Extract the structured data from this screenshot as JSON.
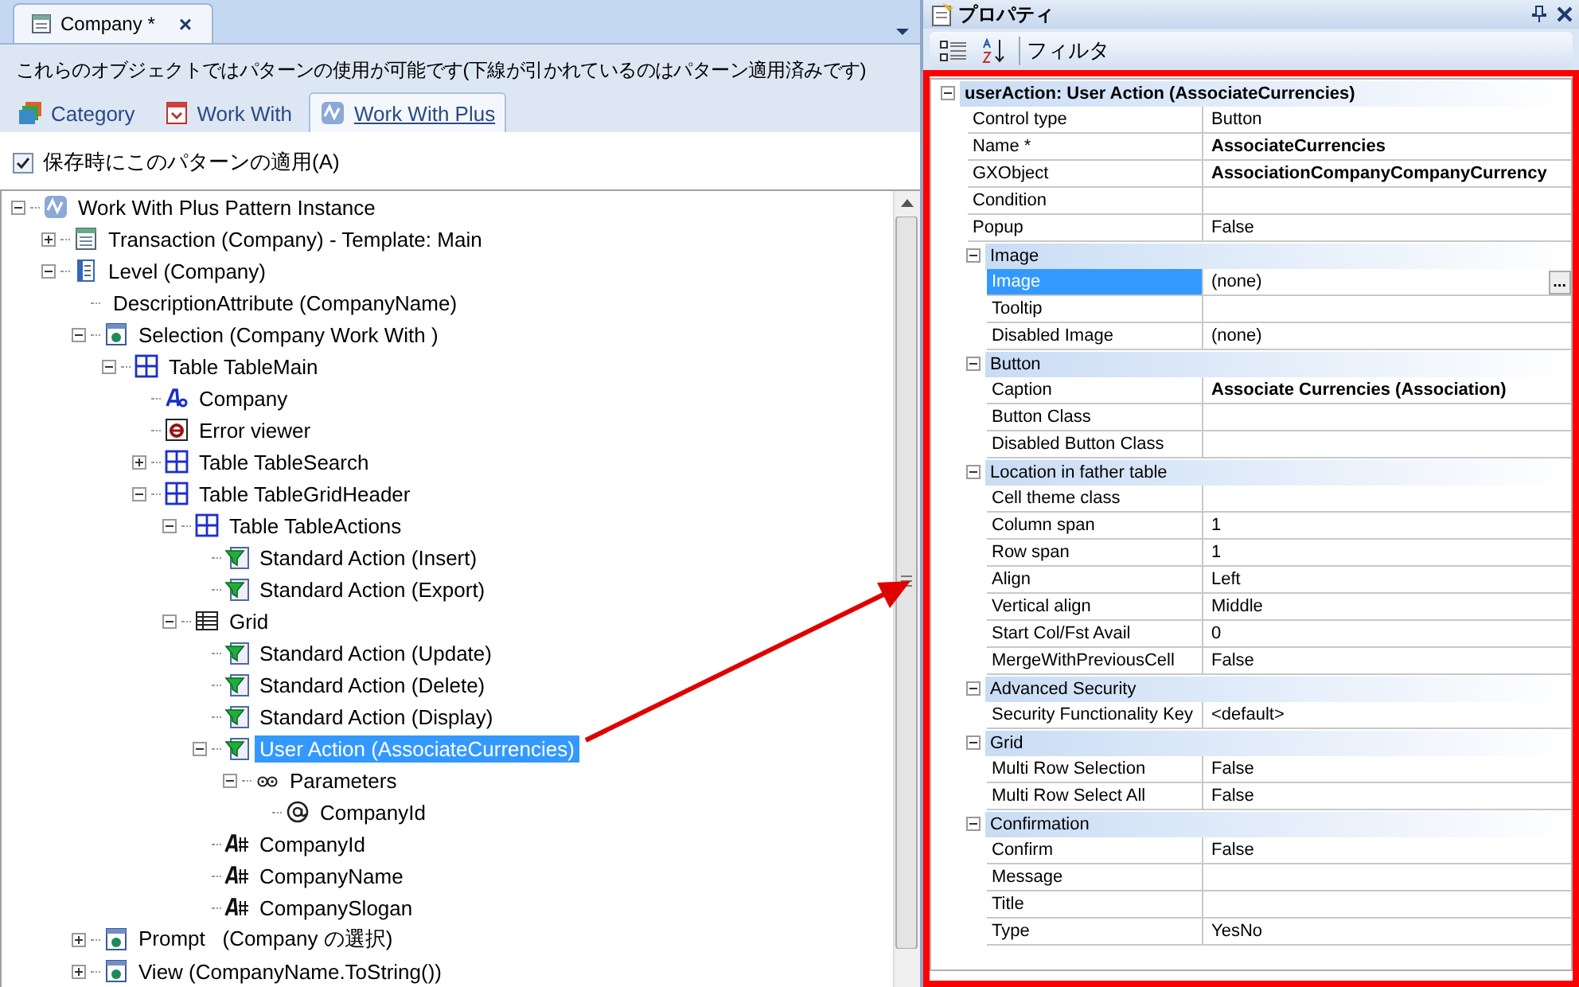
{
  "document_tab": {
    "title": "Company *",
    "close": "×"
  },
  "pattern_hint": "これらのオブジェクトではパターンの使用が可能です(下線が引かれているのはパターン適用済みです)",
  "pattern_tabs": [
    {
      "label": "Category",
      "kind": "category",
      "selected": false
    },
    {
      "label": "Work With",
      "kind": "workwith",
      "selected": false
    },
    {
      "label": "Work With Plus",
      "kind": "workwithplus",
      "selected": true
    }
  ],
  "apply_on_save": {
    "label": "保存時にこのパターンの適用(A)",
    "checked": true
  },
  "tree": [
    {
      "label": "Work With Plus Pattern Instance",
      "kind": "pattern",
      "expanded": true,
      "selected": false,
      "children": [
        {
          "label": "Transaction (Company) - Template: Main",
          "kind": "transaction",
          "expanded": false,
          "selected": false
        },
        {
          "label": "Level (Company)",
          "kind": "level",
          "expanded": true,
          "selected": false,
          "children": [
            {
              "label": "DescriptionAttribute (CompanyName)",
              "kind": "plain",
              "selected": false
            },
            {
              "label": "Selection (Company Work With )",
              "kind": "selection",
              "expanded": true,
              "selected": false,
              "children": [
                {
                  "label": "Table TableMain",
                  "kind": "table",
                  "expanded": true,
                  "selected": false,
                  "children": [
                    {
                      "label": "Company",
                      "kind": "text",
                      "selected": false
                    },
                    {
                      "label": "Error viewer",
                      "kind": "error",
                      "selected": false
                    },
                    {
                      "label": "Table TableSearch",
                      "kind": "table",
                      "expanded": false,
                      "selected": false
                    },
                    {
                      "label": "Table TableGridHeader",
                      "kind": "table",
                      "expanded": true,
                      "selected": false,
                      "children": [
                        {
                          "label": "Table TableActions",
                          "kind": "table",
                          "expanded": true,
                          "selected": false,
                          "children": [
                            {
                              "label": "Standard Action (Insert)",
                              "kind": "action",
                              "selected": false
                            },
                            {
                              "label": "Standard Action (Export)",
                              "kind": "action",
                              "selected": false
                            }
                          ]
                        },
                        {
                          "label": "Grid",
                          "kind": "grid",
                          "expanded": true,
                          "selected": false,
                          "children": [
                            {
                              "label": "Standard Action (Update)",
                              "kind": "action",
                              "selected": false
                            },
                            {
                              "label": "Standard Action (Delete)",
                              "kind": "action",
                              "selected": false
                            },
                            {
                              "label": "Standard Action (Display)",
                              "kind": "action",
                              "selected": false
                            },
                            {
                              "label": "User Action (AssociateCurrencies)",
                              "kind": "action",
                              "expanded": true,
                              "selected": true,
                              "children": [
                                {
                                  "label": "Parameters",
                                  "kind": "parameters",
                                  "expanded": true,
                                  "selected": false,
                                  "children": [
                                    {
                                      "label": "CompanyId",
                                      "kind": "parameter",
                                      "selected": false
                                    }
                                  ]
                                }
                              ]
                            },
                            {
                              "label": "CompanyId",
                              "kind": "attribute",
                              "selected": false
                            },
                            {
                              "label": "CompanyName",
                              "kind": "attribute",
                              "selected": false
                            },
                            {
                              "label": "CompanySlogan",
                              "kind": "attribute",
                              "selected": false
                            }
                          ]
                        }
                      ]
                    }
                  ]
                }
              ]
            },
            {
              "label": "Prompt   (Company の選択)",
              "kind": "selection",
              "expanded": false,
              "selected": false
            },
            {
              "label": "View (CompanyName.ToString())",
              "kind": "selection",
              "expanded": false,
              "selected": false
            }
          ]
        }
      ]
    }
  ],
  "properties_panel": {
    "title": "プロパティ",
    "filter_label": "フィルタ"
  },
  "properties": {
    "title": "userAction: User Action (AssociateCurrencies)",
    "expanded": true,
    "items": [
      {
        "name": "Control type",
        "value": "Button",
        "modified": false,
        "selected": false
      },
      {
        "name": "Name *",
        "value": "AssociateCurrencies",
        "modified": true,
        "selected": false
      },
      {
        "name": "GXObject",
        "value": "AssociationCompanyCompanyCurrency",
        "modified": true,
        "selected": false
      },
      {
        "name": "Condition",
        "modified": false,
        "selected": false
      },
      {
        "name": "Popup",
        "value": "False",
        "modified": false,
        "selected": false
      }
    ],
    "categories": [
      {
        "title": "Image",
        "expanded": true,
        "items": [
          {
            "name": "Image",
            "value": "(none)",
            "ellipsis": "...",
            "modified": false,
            "selected": true
          },
          {
            "name": "Tooltip",
            "modified": false,
            "selected": false
          },
          {
            "name": "Disabled Image",
            "value": "(none)",
            "modified": false,
            "selected": false
          }
        ]
      },
      {
        "title": "Button",
        "expanded": true,
        "items": [
          {
            "name": "Caption",
            "value": "Associate Currencies (Association)",
            "modified": true,
            "selected": false
          },
          {
            "name": "Button Class",
            "modified": false,
            "selected": false
          },
          {
            "name": "Disabled Button Class",
            "modified": false,
            "selected": false
          }
        ]
      },
      {
        "title": "Location in father table",
        "expanded": true,
        "items": [
          {
            "name": "Cell theme class",
            "modified": false,
            "selected": false
          },
          {
            "name": "Column span",
            "value": "1",
            "modified": false,
            "selected": false
          },
          {
            "name": "Row span",
            "value": "1",
            "modified": false,
            "selected": false
          },
          {
            "name": "Align",
            "value": "Left",
            "modified": false,
            "selected": false
          },
          {
            "name": "Vertical align",
            "value": "Middle",
            "modified": false,
            "selected": false
          },
          {
            "name": "Start Col/Fst Avail",
            "value": "0",
            "modified": false,
            "selected": false
          },
          {
            "name": "MergeWithPreviousCell",
            "value": "False",
            "modified": false,
            "selected": false
          }
        ]
      },
      {
        "title": "Advanced Security",
        "expanded": true,
        "items": [
          {
            "name": "Security Functionality Key",
            "value": "<default>",
            "modified": false,
            "selected": false
          }
        ]
      },
      {
        "title": "Grid",
        "expanded": true,
        "items": [
          {
            "name": "Multi Row Selection",
            "value": "False",
            "modified": false,
            "selected": false
          },
          {
            "name": "Multi Row Select All",
            "value": "False",
            "modified": false,
            "selected": false
          }
        ]
      },
      {
        "title": "Confirmation",
        "expanded": true,
        "items": [
          {
            "name": "Confirm",
            "value": "False",
            "modified": false,
            "selected": false
          },
          {
            "name": "Message",
            "modified": false,
            "selected": false
          },
          {
            "name": "Title",
            "modified": false,
            "selected": false
          },
          {
            "name": "Type",
            "value": "YesNo",
            "modified": false,
            "selected": false
          }
        ]
      }
    ]
  }
}
